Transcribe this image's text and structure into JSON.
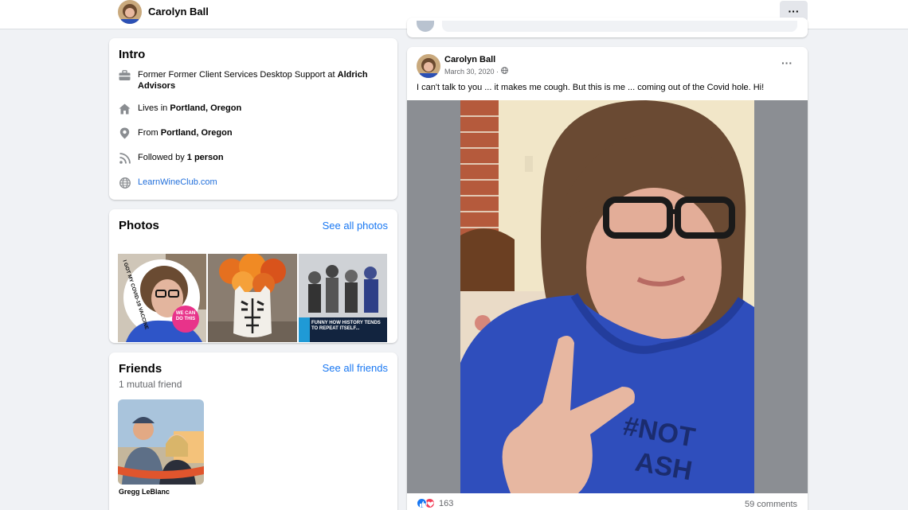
{
  "header": {
    "name": "Carolyn Ball",
    "more_label": "···"
  },
  "intro": {
    "title": "Intro",
    "work_prefix": "Former Former Client Services Desktop Support at",
    "work_place": "Aldrich Advisors",
    "lives_prefix": "Lives in",
    "lives_place": "Portland, Oregon",
    "from_prefix": "From",
    "from_place": "Portland, Oregon",
    "followed_prefix": "Followed by",
    "followed_count": "1 person",
    "website": "LearnWineClub.com",
    "icons": [
      "briefcase-icon",
      "home-icon",
      "location-pin-icon",
      "rss-icon",
      "globe-icon"
    ]
  },
  "photos": {
    "title": "Photos",
    "see_all": "See all photos",
    "items": [
      {
        "caption": "I GOT MY COVID-19 VACCINE",
        "badge": "WE CAN DO THIS"
      },
      {
        "caption": ""
      },
      {
        "caption": "FUNNY HOW HISTORY TENDS TO REPEAT ITSELF..."
      }
    ]
  },
  "friends": {
    "title": "Friends",
    "see_all": "See all friends",
    "mutual": "1 mutual friend",
    "items": [
      {
        "name": "Gregg LeBlanc"
      }
    ]
  },
  "post": {
    "author": "Carolyn Ball",
    "date": "March 30, 2020 ·",
    "text": "I can't talk to you ... it makes me cough. But this is me ... coming out of the Covid hole. Hi!",
    "more_label": "···",
    "reaction_count": "163",
    "comments": "59 comments",
    "colors": {
      "like": "#1877f2",
      "love": "#f33e58"
    }
  }
}
